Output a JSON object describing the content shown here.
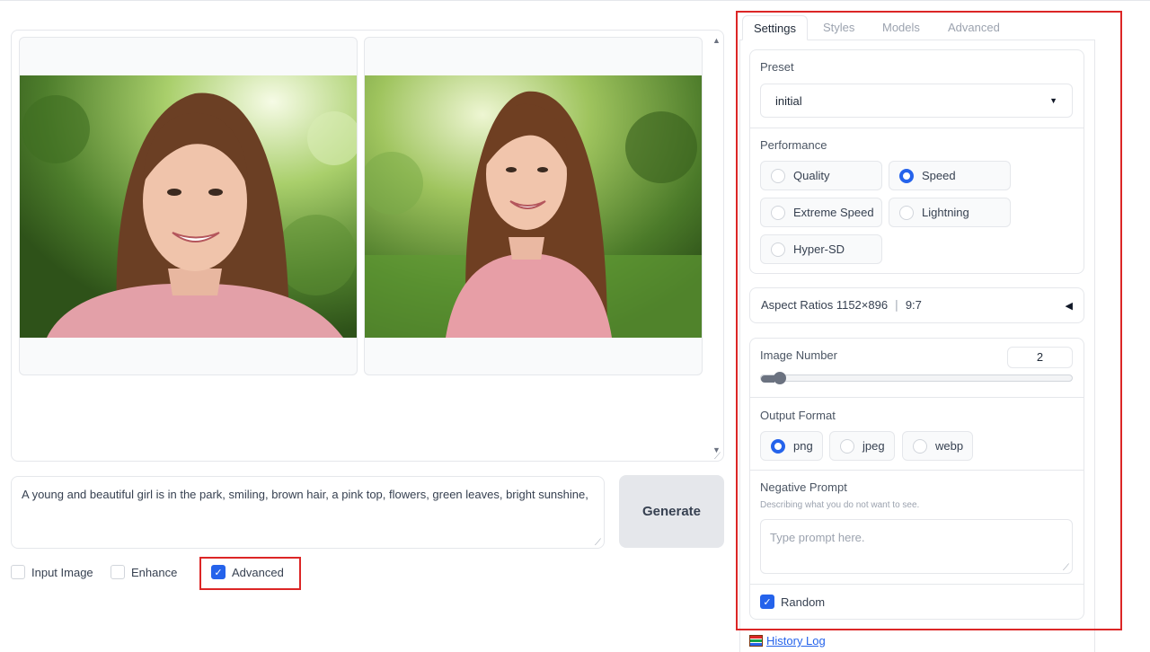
{
  "gallery": {
    "images": [
      {
        "alt_icon": "portrait-image-1"
      },
      {
        "alt_icon": "portrait-image-2"
      }
    ]
  },
  "prompt": {
    "value": "A young and beautiful girl is in the park, smiling, brown hair, a pink top, flowers, green leaves, bright sunshine,"
  },
  "generate_label": "Generate",
  "options": {
    "input_image": {
      "label": "Input Image",
      "checked": false
    },
    "enhance": {
      "label": "Enhance",
      "checked": false
    },
    "advanced": {
      "label": "Advanced",
      "checked": true
    }
  },
  "tabs": [
    "Settings",
    "Styles",
    "Models",
    "Advanced"
  ],
  "active_tab": "Settings",
  "settings": {
    "preset": {
      "label": "Preset",
      "value": "initial"
    },
    "performance": {
      "label": "Performance",
      "options": [
        "Quality",
        "Speed",
        "Extreme Speed",
        "Lightning",
        "Hyper-SD"
      ],
      "selected": "Speed"
    },
    "aspect_ratios": {
      "label": "Aspect Ratios",
      "value": "1152×896",
      "separator": "∣",
      "ratio": "9:7"
    },
    "image_number": {
      "label": "Image Number",
      "value": "2",
      "slider_fraction": 0.03
    },
    "output_format": {
      "label": "Output Format",
      "options": [
        "png",
        "jpeg",
        "webp"
      ],
      "selected": "png"
    },
    "negative_prompt": {
      "label": "Negative Prompt",
      "info": "Describing what you do not want to see.",
      "placeholder": "Type prompt here."
    },
    "random": {
      "label": "Random",
      "checked": true
    }
  },
  "history_log": {
    "label": "History Log",
    "icon": "history-log-icon"
  },
  "colors": {
    "accent": "#2563eb",
    "highlight": "#dc2626"
  }
}
